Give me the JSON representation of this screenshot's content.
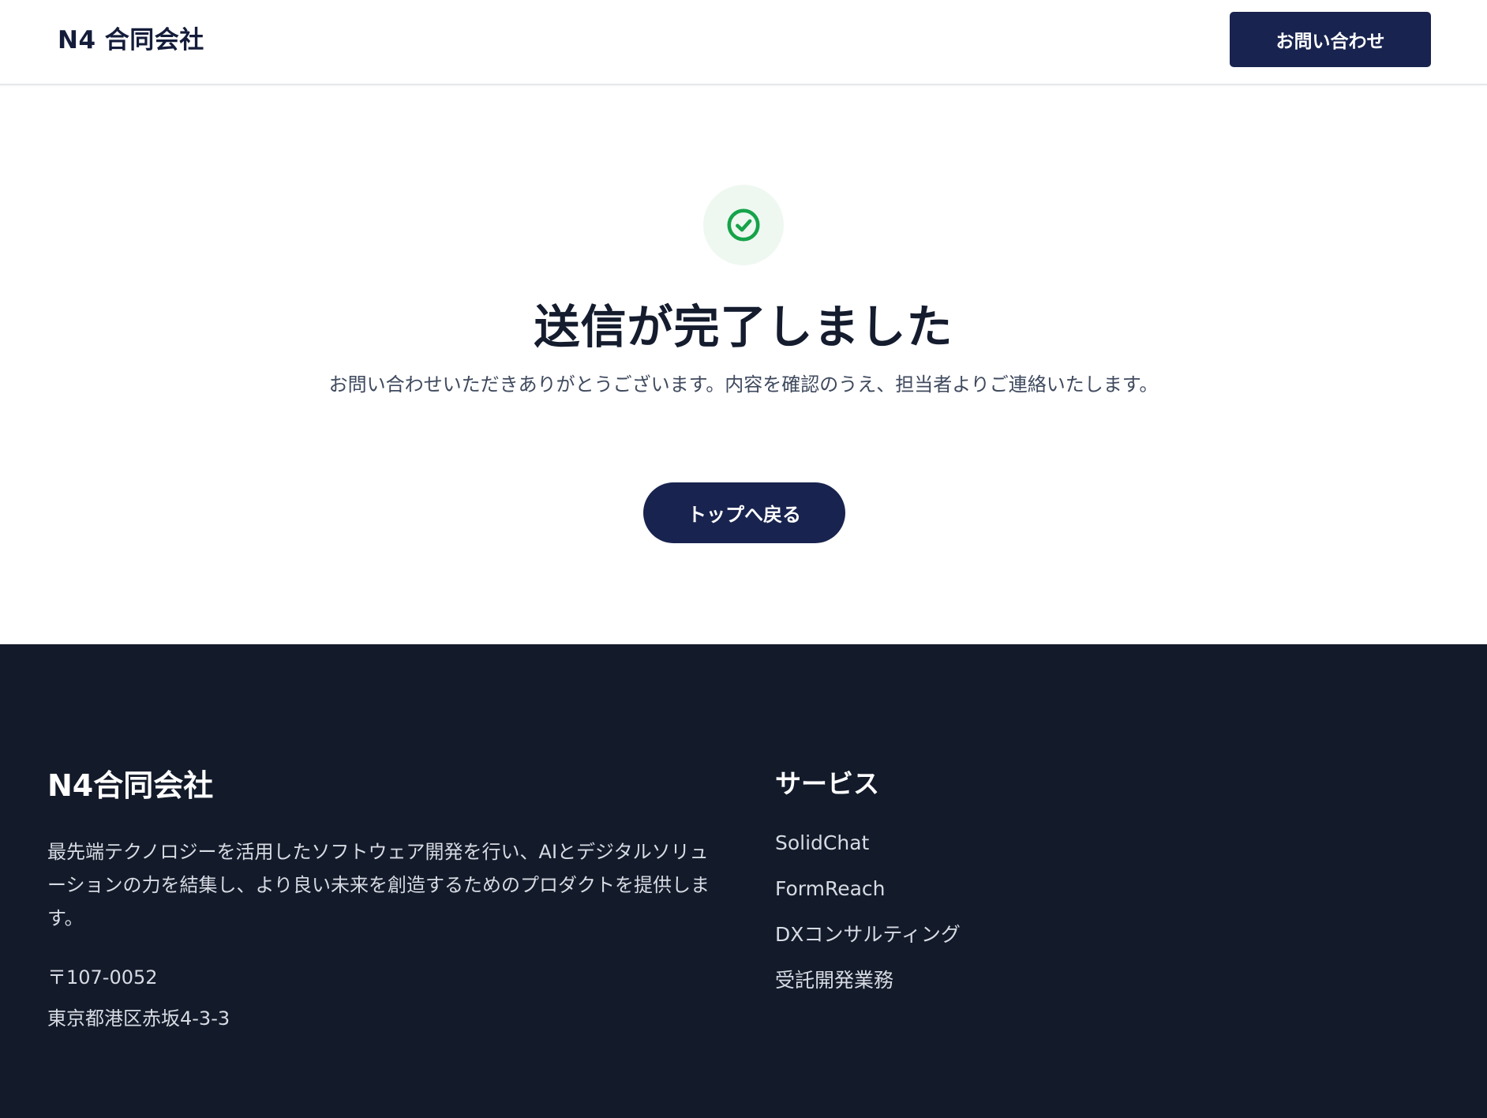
{
  "header": {
    "logo": "N4 合同会社",
    "contact_button": "お問い合わせ"
  },
  "main": {
    "icon": "check-circle-icon",
    "title": "送信が完了しました",
    "message": "お問い合わせいただきありがとうございます。内容を確認のうえ、担当者よりご連絡いたします。",
    "back_button": "トップへ戻る"
  },
  "footer": {
    "company_name": "N4合同会社",
    "description": "最先端テクノロジーを活用したソフトウェア開発を行い、AIとデジタルソリューションの力を結集し、より良い未来を創造するためのプロダクトを提供します。",
    "postal_code": "〒107-0052",
    "address": "東京都港区赤坂4-3-3",
    "services_heading": "サービス",
    "services": [
      "SolidChat",
      "FormReach",
      "DXコンサルティング",
      "受託開発業務"
    ]
  },
  "colors": {
    "primary": "#18234f",
    "footer_bg": "#131a2a",
    "success": "#16a34a",
    "success_bg": "#eef8f1"
  }
}
